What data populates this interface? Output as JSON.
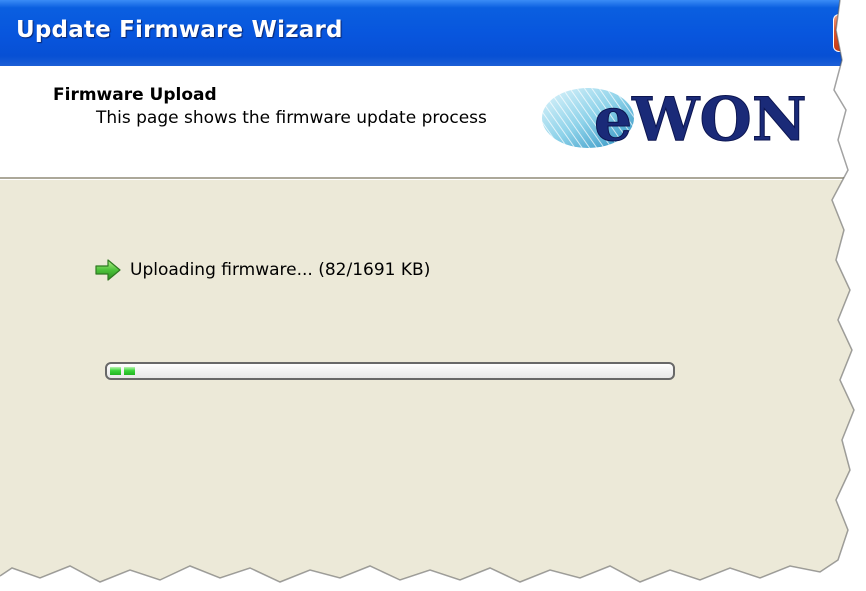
{
  "window": {
    "title": "Update Firmware Wizard"
  },
  "header": {
    "title": "Firmware Upload",
    "subtitle": "This page shows the firmware update process",
    "logo_text": "eWON"
  },
  "status": {
    "icon": "green-arrow-icon",
    "text": "Uploading firmware... (82/1691 KB)"
  },
  "progress": {
    "uploaded_kb": 82,
    "total_kb": 1691,
    "fraction": 0.048
  },
  "colors": {
    "titlebar": "#0855dd",
    "body_background": "#ece9d8",
    "progress_green": "#3bd53b",
    "arrow_green": "#4cc23a"
  }
}
